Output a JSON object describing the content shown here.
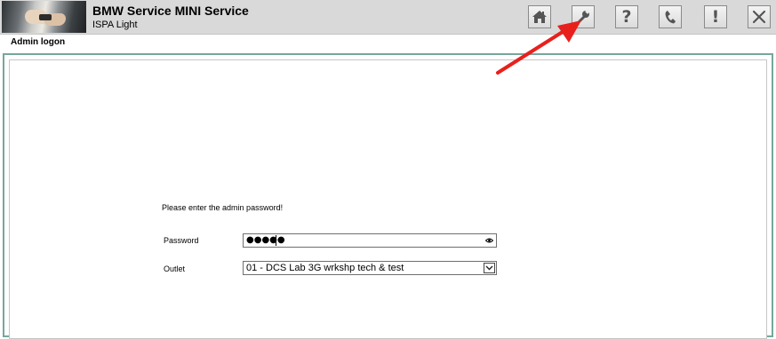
{
  "header": {
    "title": "BMW Service MINI Service",
    "subtitle": "ISPA Light",
    "toolbar": [
      {
        "name": "home-button",
        "icon": "home-icon"
      },
      {
        "name": "settings-button",
        "icon": "wrench-icon"
      },
      {
        "name": "help-button",
        "icon": "question-icon",
        "glyph": "?"
      },
      {
        "name": "phone-button",
        "icon": "phone-icon"
      },
      {
        "name": "alert-button",
        "icon": "exclamation-icon",
        "glyph": "!"
      },
      {
        "name": "close-button",
        "icon": "close-icon"
      }
    ]
  },
  "subbar": {
    "label": "Admin logon"
  },
  "form": {
    "prompt": "Please enter the admin password!",
    "password_label": "Password",
    "password_value": "●●●●●",
    "outlet_label": "Outlet",
    "outlet_value": "01 - DCS Lab 3G wrkshp tech & test"
  },
  "colors": {
    "frame_border": "#76a79a",
    "annotation_arrow": "#e8201c",
    "header_bg": "#d9d9d9"
  }
}
